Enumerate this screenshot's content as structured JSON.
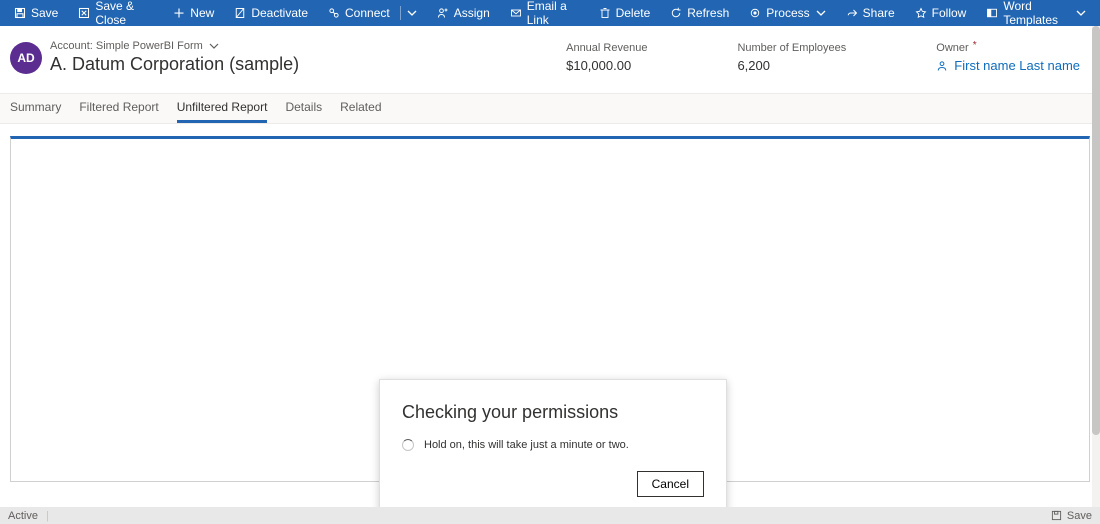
{
  "ribbon": {
    "save": "Save",
    "save_close": "Save & Close",
    "new": "New",
    "deactivate": "Deactivate",
    "connect": "Connect",
    "assign": "Assign",
    "email_link": "Email a Link",
    "delete": "Delete",
    "refresh": "Refresh",
    "process": "Process",
    "share": "Share",
    "follow": "Follow",
    "word_templates": "Word Templates"
  },
  "header": {
    "avatar_initials": "AD",
    "breadcrumb": "Account: Simple PowerBI Form",
    "title": "A. Datum Corporation (sample)"
  },
  "fields": {
    "annual_revenue": {
      "label": "Annual Revenue",
      "value": "$10,000.00"
    },
    "num_employees": {
      "label": "Number of Employees",
      "value": "6,200"
    },
    "owner": {
      "label": "Owner",
      "value": "First name Last name"
    }
  },
  "tabs": {
    "summary": "Summary",
    "filtered": "Filtered Report",
    "unfiltered": "Unfiltered Report",
    "details": "Details",
    "related": "Related"
  },
  "dialog": {
    "title": "Checking your permissions",
    "body": "Hold on, this will take just a minute or two.",
    "cancel": "Cancel"
  },
  "status": {
    "left": "Active",
    "save": "Save"
  }
}
